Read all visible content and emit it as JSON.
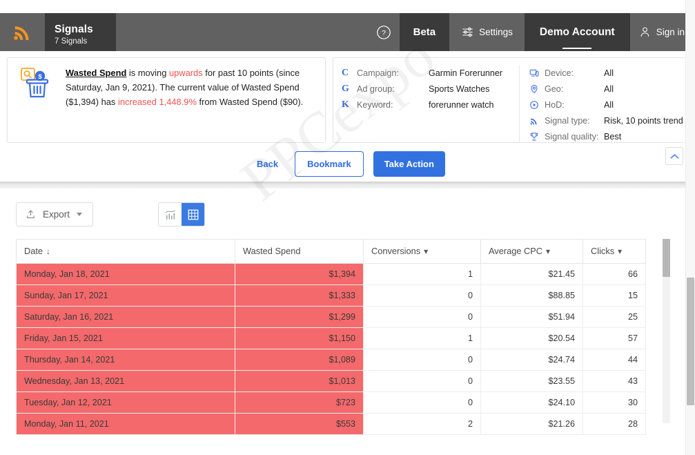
{
  "header": {
    "logo_icon": "rss-signal-icon",
    "tab": {
      "title": "Signals",
      "subtitle": "7 Signals"
    },
    "help_icon": "question-circle-icon",
    "beta_label": "Beta",
    "settings_icon": "sliders-icon",
    "settings_label": "Settings",
    "demo_account_label": "Demo Account",
    "user_icon": "person-icon",
    "signin_label": "Sign in"
  },
  "summary": {
    "icon": "wasted-spend-search-trash-icon",
    "metric": "Wasted Spend",
    "part1": " is moving ",
    "direction": "upwards",
    "part2": " for past 10 points (since Saturday, Jan 9, 2021). The current value of Wasted Spend ($1,394) has ",
    "change": "increased 1,448.9%",
    "part3": " from Wasted Spend ($90)."
  },
  "meta": {
    "left": [
      {
        "icon": "campaign-c-icon",
        "label": "Campaign:",
        "value": "Garmin Forerunner"
      },
      {
        "icon": "adgroup-g-icon",
        "label": "Ad group:",
        "value": "Sports Watches"
      },
      {
        "icon": "keyword-k-icon",
        "label": "Keyword:",
        "value": "forerunner watch"
      }
    ],
    "right": [
      {
        "icon": "device-icon",
        "label": "Device:",
        "value": "All"
      },
      {
        "icon": "geo-pin-icon",
        "label": "Geo:",
        "value": "All"
      },
      {
        "icon": "clock-hod-icon",
        "label": "HoD:",
        "value": "All"
      },
      {
        "icon": "signal-type-icon",
        "label": "Signal type:",
        "value": "Risk, 10 points trend"
      },
      {
        "icon": "trophy-icon",
        "label": "Signal quality:",
        "value": "Best"
      }
    ]
  },
  "actions": {
    "back_label": "Back",
    "bookmark_label": "Bookmark",
    "take_action_label": "Take Action",
    "collapse_icon": "chevron-up-icon"
  },
  "toolbar": {
    "export_icon": "upload-icon",
    "export_label": "Export",
    "chart_view_icon": "bar-chart-icon",
    "table_view_icon": "grid-table-icon"
  },
  "watermark": "PPCexpo",
  "table": {
    "columns": [
      {
        "label": "Date",
        "sort": "↓"
      },
      {
        "label": "Wasted Spend",
        "sort": ""
      },
      {
        "label": "Conversions",
        "sort": "▾"
      },
      {
        "label": "Average CPC",
        "sort": "▾"
      },
      {
        "label": "Clicks",
        "sort": "▾"
      }
    ],
    "rows": [
      {
        "date": "Monday, Jan 18, 2021",
        "spend": "$1,394",
        "conversions": "1",
        "avg_cpc": "$21.45",
        "clicks": "66"
      },
      {
        "date": "Sunday, Jan 17, 2021",
        "spend": "$1,333",
        "conversions": "0",
        "avg_cpc": "$88.85",
        "clicks": "15"
      },
      {
        "date": "Saturday, Jan 16, 2021",
        "spend": "$1,299",
        "conversions": "0",
        "avg_cpc": "$51.94",
        "clicks": "25"
      },
      {
        "date": "Friday, Jan 15, 2021",
        "spend": "$1,150",
        "conversions": "1",
        "avg_cpc": "$20.54",
        "clicks": "57"
      },
      {
        "date": "Thursday, Jan 14, 2021",
        "spend": "$1,089",
        "conversions": "0",
        "avg_cpc": "$24.74",
        "clicks": "44"
      },
      {
        "date": "Wednesday, Jan 13, 2021",
        "spend": "$1,013",
        "conversions": "0",
        "avg_cpc": "$23.55",
        "clicks": "43"
      },
      {
        "date": "Tuesday, Jan 12, 2021",
        "spend": "$723",
        "conversions": "0",
        "avg_cpc": "$24.10",
        "clicks": "30"
      },
      {
        "date": "Monday, Jan 11, 2021",
        "spend": "$553",
        "conversions": "2",
        "avg_cpc": "$21.26",
        "clicks": "28"
      }
    ]
  },
  "colors": {
    "brand_orange": "#F7941E",
    "header_dark": "#3A3A3A",
    "header_light": "#616161",
    "accent_blue": "#3272E0",
    "alert_red": "#F4696B",
    "text_red": "#EF5350"
  }
}
